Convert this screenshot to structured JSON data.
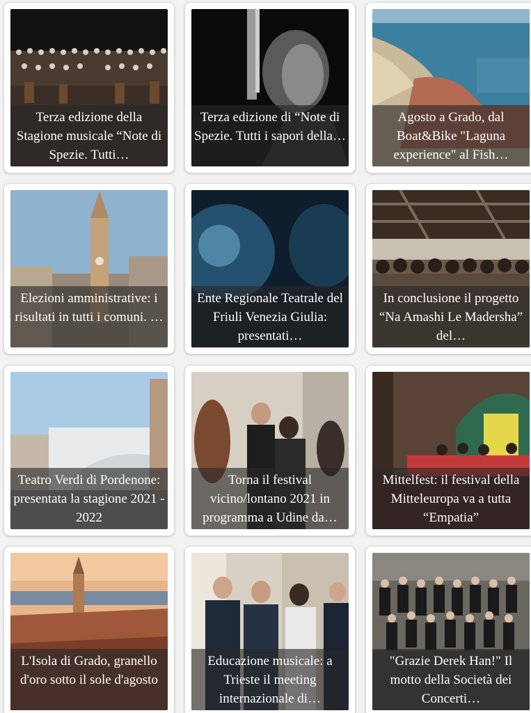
{
  "cards": [
    {
      "title": "Terza edizione della Stagione musicale “Note di Spezie. Tutti…"
    },
    {
      "title": "Terza edizione di “Note di Spezie. Tutti i sapori della…"
    },
    {
      "title": "Agosto a Grado, dal Boat&Bike \"Laguna experience\" al Fish…"
    },
    {
      "title": "Elezioni amministrative: i risultati in tutti i comuni. …"
    },
    {
      "title": "Ente Regionale Teatrale del Friuli Venezia Giulia: presentati…"
    },
    {
      "title": "In conclusione il progetto “Na Amashi Le Madersha” del…"
    },
    {
      "title": "Teatro Verdi di Pordenone: presentata la stagione 2021 - 2022"
    },
    {
      "title": "Torna il festival vicino/lontano 2021 in programma a Udine da…"
    },
    {
      "title": "Mittelfest: il festival della Mitteleuropa va a tutta “Empatia”"
    },
    {
      "title": "L'Isola di Grado, granello d'oro sotto il sole d'agosto"
    },
    {
      "title": "Educazione musicale: a Trieste il meeting internazionale di…"
    },
    {
      "title": "\"Grazie Derek Han!\" Il motto della Società dei Concerti…"
    }
  ]
}
